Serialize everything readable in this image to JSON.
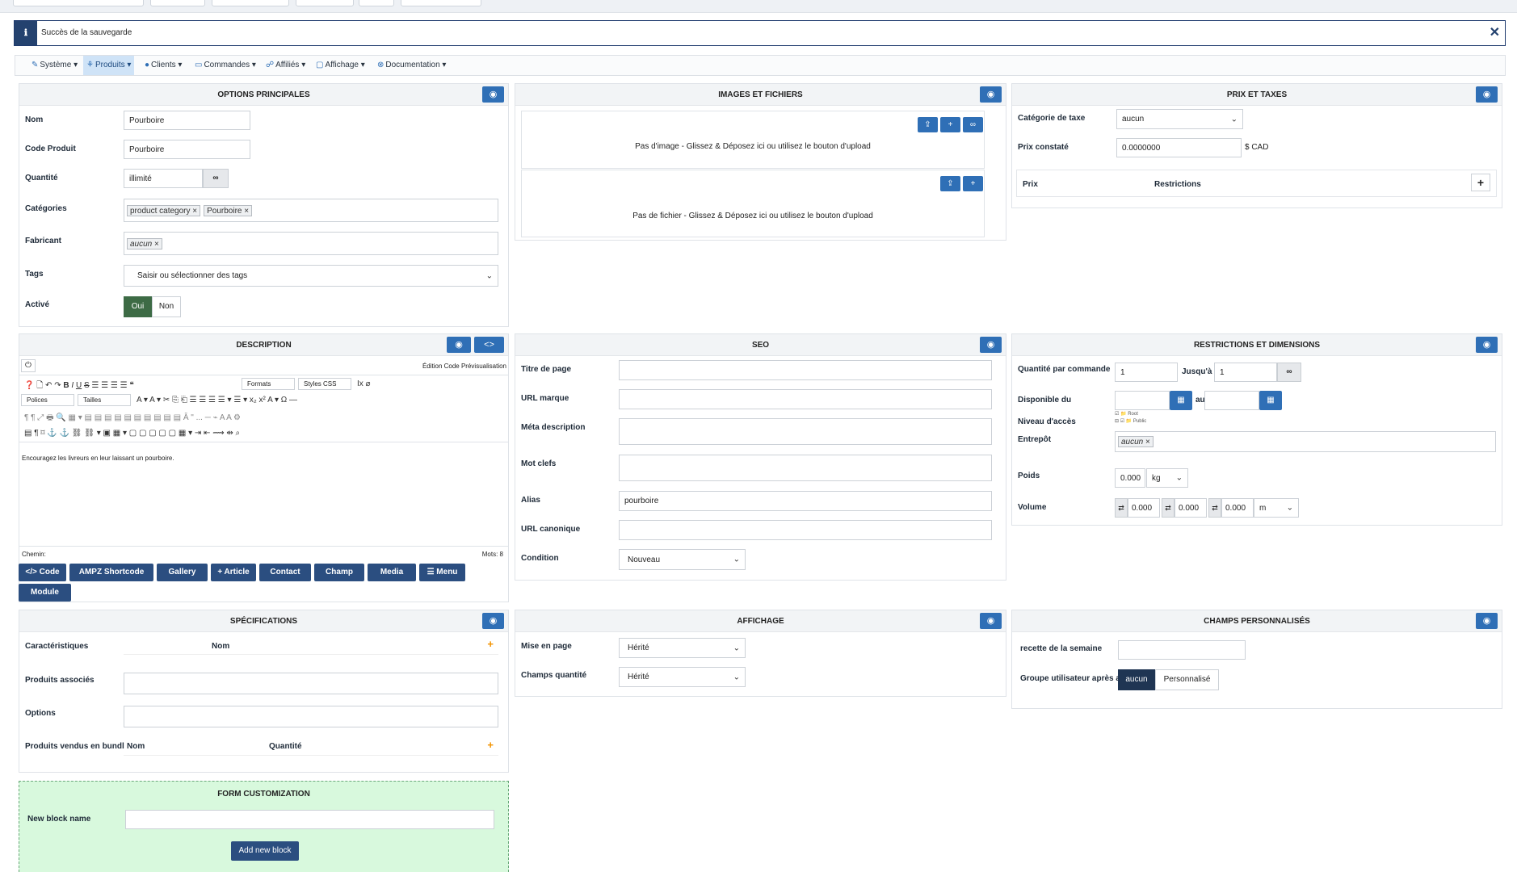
{
  "alert": {
    "message": "Succès de la sauvegarde",
    "close": "✕",
    "icon": "info-icon"
  },
  "menu": [
    {
      "label": "Système ▾",
      "icon": "✎"
    },
    {
      "label": "Produits ▾",
      "icon": "☍"
    },
    {
      "label": "Clients ▾",
      "icon": "👤"
    },
    {
      "label": "Commandes ▾",
      "icon": "▭"
    },
    {
      "label": "Affiliés ▾",
      "icon": "☍"
    },
    {
      "label": "Affichage ▾",
      "icon": "▢"
    },
    {
      "label": "Documentation ▾",
      "icon": "⊗"
    }
  ],
  "options": {
    "title": "OPTIONS PRINCIPALES",
    "nom_label": "Nom",
    "nom_value": "Pourboire",
    "code_label": "Code Produit",
    "code_value": "Pourboire",
    "qte_label": "Quantité",
    "qte_value": "illimité",
    "cat_label": "Catégories",
    "cat_tags": [
      "product category",
      "Pourboire"
    ],
    "fab_label": "Fabricant",
    "fab_tag": "aucun",
    "tags_label": "Tags",
    "tags_placeholder": "Saisir ou sélectionner des tags",
    "active_label": "Activé",
    "oui": "Oui",
    "non": "Non"
  },
  "images": {
    "title": "IMAGES ET FICHIERS",
    "no_image": "Pas d'image - Glissez & Déposez ici ou utilisez le bouton d'upload",
    "no_file": "Pas de fichier - Glissez & Déposez ici ou utilisez le bouton d'upload"
  },
  "prix": {
    "title": "PRIX ET TAXES",
    "taxcat_label": "Catégorie de taxe",
    "taxcat_value": "aucun",
    "prixc_label": "Prix constaté",
    "prixc_value": "0.0000000",
    "currency": "$ CAD",
    "col_prix": "Prix",
    "col_restrictions": "Restrictions"
  },
  "description": {
    "title": "DESCRIPTION",
    "mode": "Édition Code Prévisualisation",
    "formats": "Formats",
    "styles": "Styles CSS",
    "polices": "Polices",
    "tailles": "Tailles",
    "content": "Encouragez les livreurs en leur laissant un pourboire.",
    "path": "Chemin:",
    "words": "Mots: 8",
    "buttons": [
      "</> Code",
      "AMPZ Shortcode",
      "Gallery",
      "+ Article",
      "Contact",
      "Champ",
      "Media",
      "☰ Menu",
      "Module"
    ]
  },
  "seo": {
    "title": "SEO",
    "titre_page": "Titre de page",
    "url_marque": "URL marque",
    "meta": "Méta description",
    "mots": "Mot clefs",
    "alias": "Alias",
    "alias_value": "pourboire",
    "canon": "URL canonique",
    "condition": "Condition",
    "condition_value": "Nouveau"
  },
  "restrictions": {
    "title": "RESTRICTIONS ET DIMENSIONS",
    "qpc_label": "Quantité par commande",
    "qpc_from": "1",
    "jusqua": "Jusqu'à",
    "qpc_to": "1",
    "dispo_label": "Disponible du",
    "au": "au",
    "niveau_label": "Niveau d'accès",
    "access1": "Root",
    "access2": "Public",
    "entrepot_label": "Entrepôt",
    "entrepot_tag": "aucun",
    "poids_label": "Poids",
    "poids_value": "0.000",
    "poids_unit": "kg",
    "volume_label": "Volume",
    "v1": "0.000",
    "v2": "0.000",
    "v3": "0.000",
    "v_unit": "m"
  },
  "specs": {
    "title": "SPÉCIFICATIONS",
    "carac": "Caractéristiques",
    "nom": "Nom",
    "assoc": "Produits associés",
    "options": "Options",
    "bundle": "Produits vendus en bundl",
    "b_nom": "Nom",
    "b_qte": "Quantité"
  },
  "affichage": {
    "title": "AFFICHAGE",
    "mise": "Mise en page",
    "mise_value": "Hérité",
    "champs": "Champs quantité",
    "champs_value": "Hérité"
  },
  "custom": {
    "title": "CHAMPS PERSONNALISÉS",
    "recette": "recette de la semaine",
    "groupe": "Groupe utilisateur après a",
    "aucun": "aucun",
    "perso": "Personnalisé"
  },
  "form": {
    "title": "FORM CUSTOMIZATION",
    "new_block": "New block name",
    "add": "Add new block"
  }
}
